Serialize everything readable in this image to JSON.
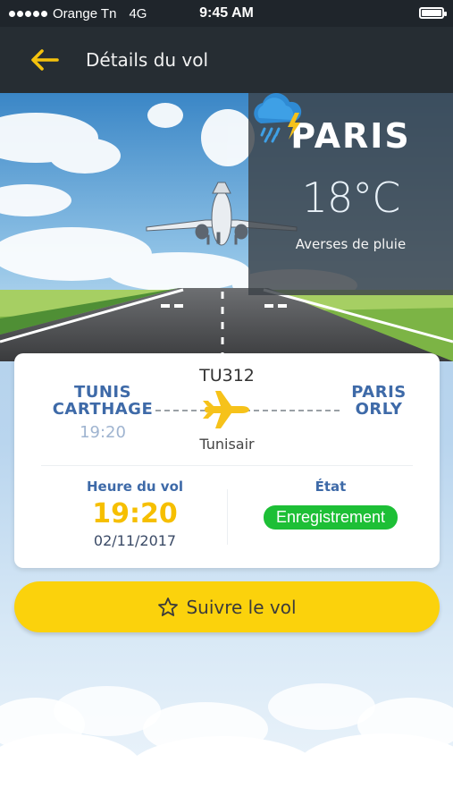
{
  "status_bar": {
    "carrier": "Orange Tn",
    "network": "4G",
    "time": "9:45 AM",
    "battery_level": 1.0
  },
  "header": {
    "back_icon": "arrow-left-icon",
    "title": "Détails du vol"
  },
  "hero": {
    "city": "PARIS",
    "weather_icon": "rain-thunder-cloud-icon",
    "temperature": "18°C",
    "weather_description": "Averses de pluie"
  },
  "flight_card": {
    "flight_number": "TU312",
    "origin": {
      "line1": "TUNIS",
      "line2": "CARTHAGE",
      "time": "19:20"
    },
    "destination": {
      "line1": "PARIS",
      "line2": "ORLY"
    },
    "airline": "Tunisair",
    "plane_icon": "airplane-icon",
    "flight_time_label": "Heure du vol",
    "flight_time": "19:20",
    "flight_date": "02/11/2017",
    "status_label": "État",
    "status_value": "Enregistrement"
  },
  "follow_button": {
    "icon": "star-icon",
    "label": "Suivre le vol"
  },
  "colors": {
    "accent_yellow": "#fbd20c",
    "time_yellow": "#f6bf00",
    "airport_blue": "#3e6aa8",
    "status_green": "#1dbf36",
    "header_dark": "#262d33"
  }
}
